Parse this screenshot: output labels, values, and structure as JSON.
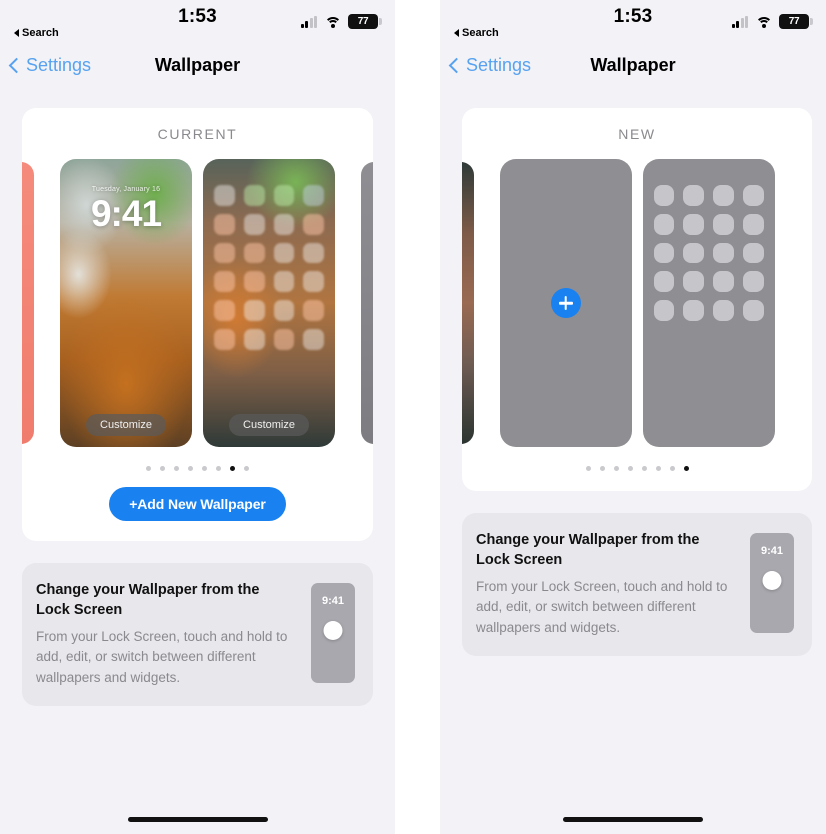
{
  "screens": [
    {
      "id": "current",
      "status_bar": {
        "time": "1:53",
        "back_label": "Search",
        "battery_level": "77",
        "icons": {
          "cellular": "cellular-bars-icon",
          "wifi": "wifi-icon",
          "battery": "battery-icon"
        }
      },
      "nav": {
        "back_label": "Settings",
        "title": "Wallpaper"
      },
      "wallpaper_section": {
        "label": "CURRENT",
        "lock_screen": {
          "date": "Tuesday, January 16",
          "time": "9:41",
          "customize_label": "Customize"
        },
        "home_screen": {
          "customize_label": "Customize"
        },
        "dots_total": 8,
        "dots_active_index": 6,
        "add_button_label": "+Add New Wallpaper"
      },
      "info_card": {
        "title": "Change your Wallpaper from the Lock Screen",
        "body": "From your Lock Screen, touch and hold to add, edit, or switch between different wallpapers and widgets.",
        "mini_phone_time": "9:41"
      }
    },
    {
      "id": "new",
      "status_bar": {
        "time": "1:53",
        "back_label": "Search",
        "battery_level": "77",
        "icons": {
          "cellular": "cellular-bars-icon",
          "wifi": "wifi-icon",
          "battery": "battery-icon"
        }
      },
      "nav": {
        "back_label": "Settings",
        "title": "Wallpaper"
      },
      "wallpaper_section": {
        "label": "NEW",
        "add_placeholder": {
          "plus_icon": "plus-icon"
        },
        "dots_total": 8,
        "dots_active_index": 7
      },
      "info_card": {
        "title": "Change your Wallpaper from the Lock Screen",
        "body": "From your Lock Screen, touch and hold to add, edit, or switch between different wallpapers and widgets.",
        "mini_phone_time": "9:41"
      }
    }
  ],
  "colors": {
    "accent_blue": "#1a82f0",
    "nav_link_blue": "#57a2f0",
    "page_background": "#f2f2f7",
    "card_background": "#ffffff",
    "info_card_background": "#e7e7ec",
    "placeholder_gray": "#8e8e93",
    "secondary_text": "#8a8a8e"
  }
}
